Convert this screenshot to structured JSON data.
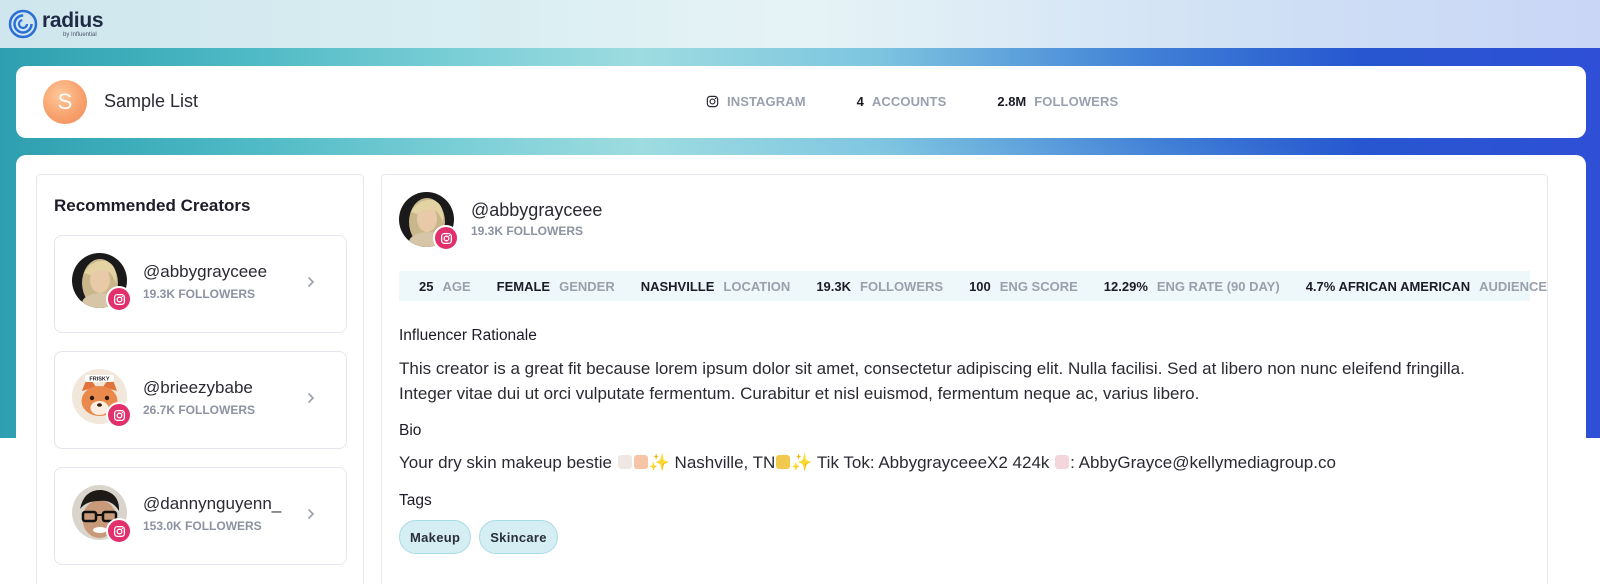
{
  "app": {
    "logo_word": "radius",
    "logo_sub": "by Influential"
  },
  "list": {
    "avatar_letter": "S",
    "name": "Sample List",
    "platform_label": "INSTAGRAM",
    "accounts_value": "4",
    "accounts_label": "ACCOUNTS",
    "followers_value": "2.8M",
    "followers_label": "FOLLOWERS"
  },
  "sidebar": {
    "title": "Recommended Creators",
    "creators": [
      {
        "handle": "@abbygrayceee",
        "followers": "19.3K FOLLOWERS",
        "avatar": "blonde-woman-avatar"
      },
      {
        "handle": "@brieezybabe",
        "followers": "26.7K FOLLOWERS",
        "avatar": "fox-cartoon-avatar"
      },
      {
        "handle": "@dannynguyenn_",
        "followers": "153.0K FOLLOWERS",
        "avatar": "man-glasses-avatar"
      }
    ]
  },
  "detail": {
    "handle": "@abbygrayceee",
    "followers": "19.3K FOLLOWERS",
    "metrics": [
      {
        "value": "25",
        "label": "AGE"
      },
      {
        "value": "FEMALE",
        "label": "GENDER"
      },
      {
        "value": "NASHVILLE",
        "label": "LOCATION"
      },
      {
        "value": "19.3K",
        "label": "FOLLOWERS"
      },
      {
        "value": "100",
        "label": "ENG SCORE"
      },
      {
        "value": "12.29%",
        "label": "ENG RATE (90 DAY)"
      },
      {
        "value": "4.7% AFRICAN AMERICAN",
        "label": "AUDIENCE"
      }
    ],
    "rationale_heading": "Influencer Rationale",
    "rationale_text": "This creator is a great fit because lorem ipsum dolor sit amet, consectetur adipiscing elit. Nulla facilisi. Sed at libero non nunc eleifend fringilla. Integer vitae dui ut orci vulputate fermentum. Curabitur et nisl euismod, fermentum neque ac, varius libero.",
    "bio_heading": "Bio",
    "bio_part1": "Your dry skin makeup bestie",
    "bio_part2": "✨ Nashville, TN",
    "bio_part3": "✨ Tik Tok: AbbygrayceeeX2 424k",
    "bio_part4": ": AbbyGrayce@kellymediagroup.co",
    "tags_heading": "Tags",
    "tags": [
      "Makeup",
      "Skincare"
    ]
  },
  "colors": {
    "instagram": "#e1306c",
    "tag_bg": "#d4eef4",
    "metrics_bg": "#eef7f9",
    "muted_label": "#9aa0ad"
  }
}
